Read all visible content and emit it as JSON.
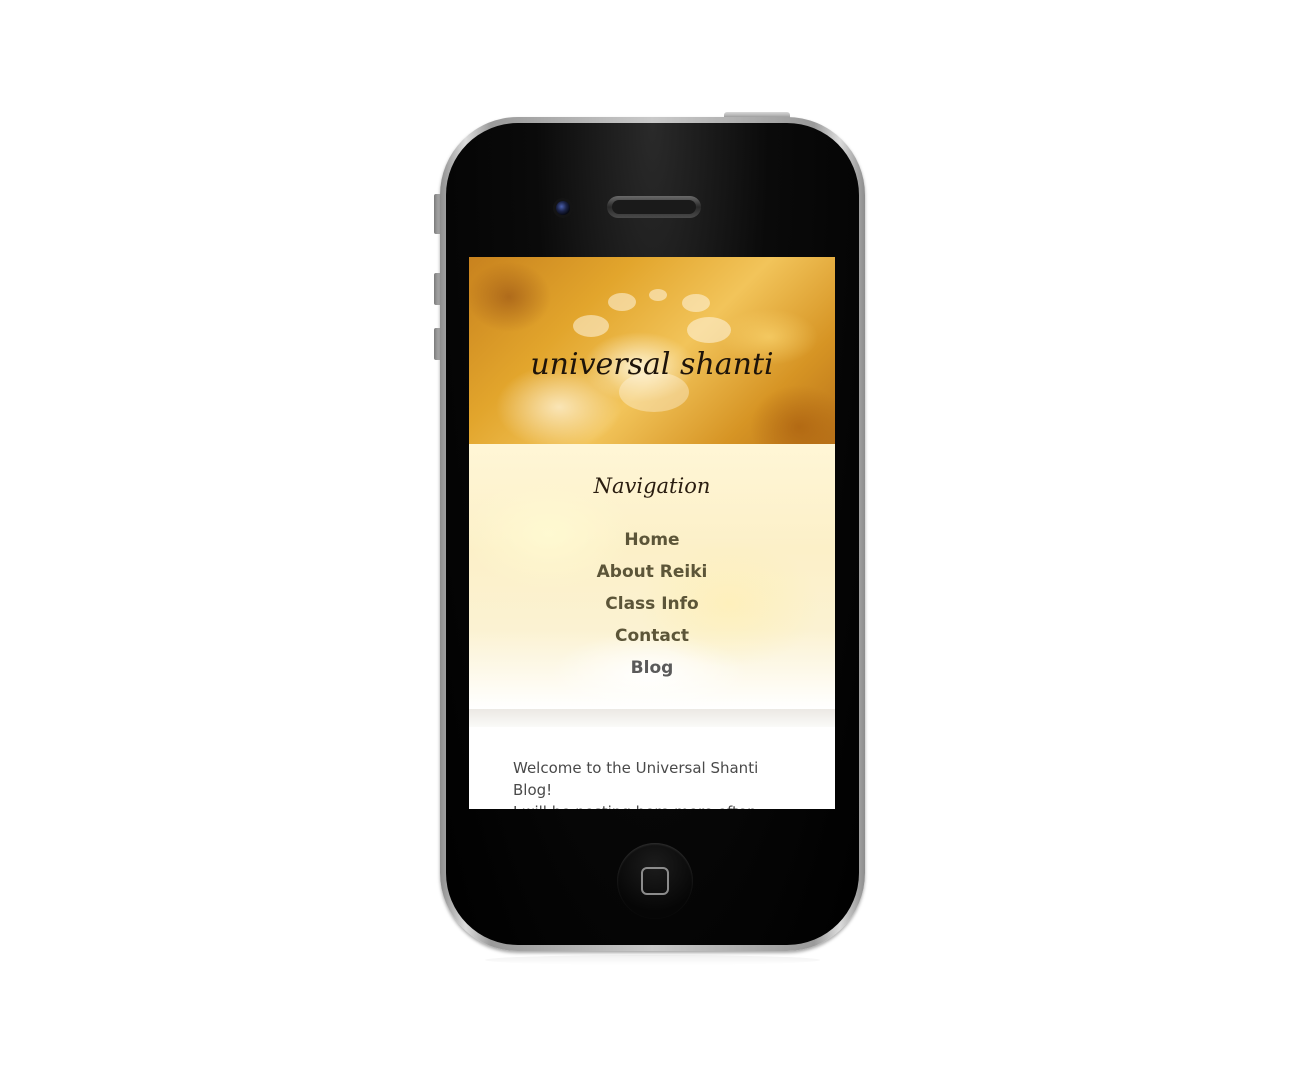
{
  "device": {
    "type": "smartphone"
  },
  "site": {
    "title": "universal shanti"
  },
  "navigation": {
    "heading": "Navigation",
    "items": [
      {
        "label": "Home"
      },
      {
        "label": "About Reiki"
      },
      {
        "label": "Class Info"
      },
      {
        "label": "Contact"
      },
      {
        "label": "Blog"
      }
    ]
  },
  "content": {
    "intro": "Welcome to the Universal Shanti Blog!",
    "next_line_partial": "I will be posting here more often"
  },
  "colors": {
    "nav_link": "#5c5538",
    "header_gold": "#e2a52c",
    "body_text": "#4a4a4a"
  }
}
